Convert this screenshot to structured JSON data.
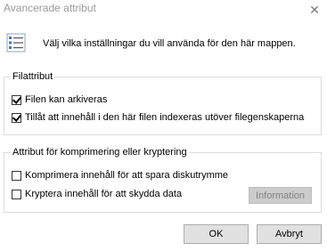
{
  "window": {
    "title": "Avancerade attribut"
  },
  "intro": {
    "icon": "properties-list-icon",
    "text": "Välj vilka inställningar du vill använda för den här mappen."
  },
  "file_attributes": {
    "title": "Filattribut",
    "archive": {
      "label": "Filen kan arkiveras",
      "checked": true
    },
    "index": {
      "label": "Tillåt att innehåll i den här filen indexeras utöver filegenskaperna",
      "checked": true
    }
  },
  "compress_encrypt": {
    "title": "Attribut för komprimering eller kryptering",
    "compress": {
      "label": "Komprimera innehåll för att spara diskutrymme",
      "checked": false
    },
    "encrypt": {
      "label": "Kryptera innehåll för att skydda data",
      "checked": false
    },
    "info_button": "Information"
  },
  "buttons": {
    "ok": "OK",
    "cancel": "Avbryt"
  }
}
